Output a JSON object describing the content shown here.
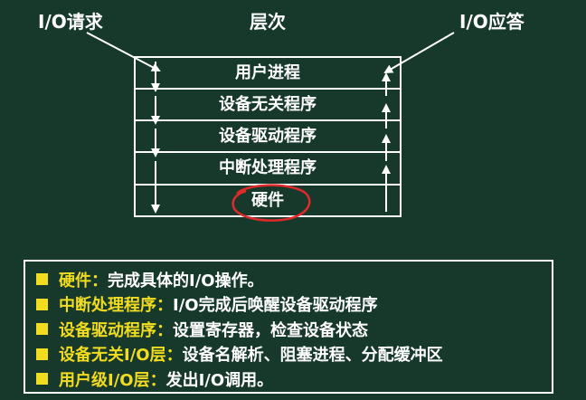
{
  "header": {
    "io_request": "I/O请求",
    "layers": "层次",
    "io_reply": "I/O应答"
  },
  "layers": [
    "用户进程",
    "设备无关程序",
    "设备驱动程序",
    "中断处理程序",
    "硬件"
  ],
  "notes": [
    {
      "term": "硬件",
      "desc": "完成具体的I/O操作。"
    },
    {
      "term": "中断处理程序",
      "desc": "I/O完成后唤醒设备驱动程序"
    },
    {
      "term": "设备驱动程序",
      "desc": "设置寄存器，检查设备状态"
    },
    {
      "term": "设备无关I/O层",
      "desc": "设备名解析、阻塞进程、分配缓冲区"
    },
    {
      "term": "用户级I/O层",
      "desc": "发出I/O调用。"
    }
  ],
  "colors": {
    "background": "#17392c",
    "bullet": "#f2dc20",
    "term_text": "#f2dc20",
    "body_text": "#ffffff",
    "highlight_circle": "#e02a2a"
  },
  "punctuation": {
    "colon": "："
  }
}
